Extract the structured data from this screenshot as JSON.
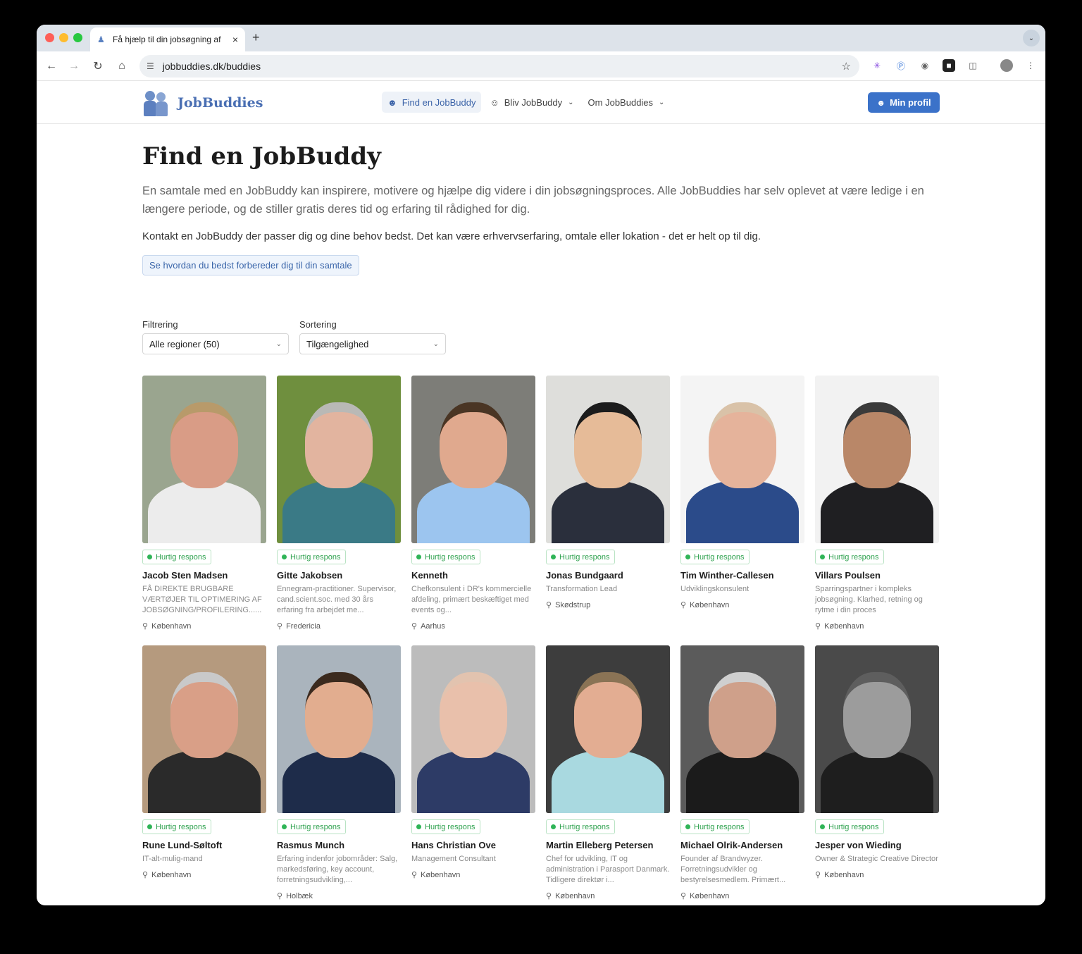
{
  "browser": {
    "tab_title": "Få hjælp til din jobsøgning af",
    "url": "jobbuddies.dk/buddies"
  },
  "site": {
    "logo_text": "JobBuddies",
    "nav": [
      {
        "label": "Find en JobBuddy"
      },
      {
        "label": "Bliv JobBuddy"
      },
      {
        "label": "Om JobBuddies"
      }
    ],
    "profile_label": "Min profil"
  },
  "page": {
    "title": "Find en JobBuddy",
    "lead": "En samtale med en JobBuddy kan inspirere, motivere og hjælpe dig videre i din jobsøgningsproces. Alle JobBuddies har selv oplevet at være ledige i en længere periode, og de stiller gratis deres tid og erfaring til rådighed for dig.",
    "lead2": "Kontakt en JobBuddy der passer dig og dine behov bedst. Det kan være erhvervserfaring, omtale eller lokation - det er helt op til dig.",
    "prep_link": "Se hvordan du bedst forbereder dig til din samtale"
  },
  "filters": {
    "filter_label": "Filtrering",
    "filter_value": "Alle regioner (50)",
    "sort_label": "Sortering",
    "sort_value": "Tilgængelighed"
  },
  "badge_label": "Hurtig respons",
  "buddies": [
    {
      "name": "Jacob Sten Madsen",
      "desc": "FÅ DIREKTE BRUGBARE VÆRTØJER TIL OPTIMERING AF JOBSØGNING/PROFILERING......",
      "location": "København"
    },
    {
      "name": "Gitte Jakobsen",
      "desc": "Ennegram-practitioner. Supervisor, cand.scient.soc. med 30 års erfaring fra arbejdet me...",
      "location": "Fredericia"
    },
    {
      "name": "Kenneth",
      "desc": "Chefkonsulent i DR's kommercielle afdeling, primært beskæftiget med events og...",
      "location": "Aarhus"
    },
    {
      "name": "Jonas Bundgaard",
      "desc": "Transformation Lead",
      "location": "Skødstrup"
    },
    {
      "name": "Tim Winther-Callesen",
      "desc": "Udviklingskonsulent",
      "location": "København"
    },
    {
      "name": "Villars Poulsen",
      "desc": "Sparringspartner i kompleks jobsøgning. Klarhed, retning og rytme i din proces",
      "location": "København"
    },
    {
      "name": "Rune Lund-Søltoft",
      "desc": "IT-alt-mulig-mand",
      "location": "København"
    },
    {
      "name": "Rasmus Munch",
      "desc": "Erfaring indenfor jobområder: Salg, markedsføring, key account, forretningsudvikling,...",
      "location": "Holbæk"
    },
    {
      "name": "Hans Christian Ove",
      "desc": "Management Consultant",
      "location": "København"
    },
    {
      "name": "Martin Elleberg Petersen",
      "desc": "Chef for udvikling, IT og administration i Parasport Danmark. Tidligere direktør i...",
      "location": "København"
    },
    {
      "name": "Michael Olrik-Andersen",
      "desc": "Founder af Brandwyzer. Forretningsudvikler og bestyrelsesmedlem. Primært...",
      "location": "København"
    },
    {
      "name": "Jesper von Wieding",
      "desc": "Owner & Strategic Creative Director",
      "location": "København"
    }
  ]
}
